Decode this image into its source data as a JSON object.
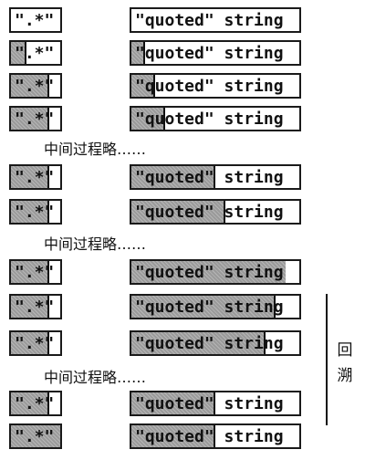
{
  "pattern_text": "\".*\"",
  "subject_text": "\"quoted\" string",
  "ellipsis_note": "中间过程略……",
  "backtrack_label": "回溯",
  "colors": {
    "border": "#1a1a1a",
    "shaded": "#9a9a9a",
    "background": "#ffffff"
  },
  "steps": [
    {
      "pattern_matched": 0,
      "pattern_cursor": 0,
      "subject_matched": 0,
      "subject_cursor": 0
    },
    {
      "pattern_matched": 1,
      "pattern_cursor": 1,
      "subject_matched": 1,
      "subject_cursor": 1
    },
    {
      "pattern_matched": 3,
      "pattern_cursor": 3,
      "subject_matched": 2,
      "subject_cursor": 2
    },
    {
      "pattern_matched": 3,
      "pattern_cursor": 3,
      "subject_matched": 3,
      "subject_cursor": 3
    },
    {
      "note": true
    },
    {
      "pattern_matched": 3,
      "pattern_cursor": 3,
      "subject_matched": 8,
      "subject_cursor": 8
    },
    {
      "pattern_matched": 3,
      "pattern_cursor": 3,
      "subject_matched": 9,
      "subject_cursor": 9
    },
    {
      "note": true
    },
    {
      "pattern_matched": 3,
      "pattern_cursor": 3,
      "subject_matched": 15,
      "subject_cursor": 15
    },
    {
      "pattern_matched": 3,
      "pattern_cursor": 3,
      "subject_matched": 14,
      "subject_cursor": 14
    },
    {
      "pattern_matched": 3,
      "pattern_cursor": 3,
      "subject_matched": 13,
      "subject_cursor": 13
    },
    {
      "note": true
    },
    {
      "pattern_matched": 3,
      "pattern_cursor": 3,
      "subject_matched": 8,
      "subject_cursor": 8
    },
    {
      "pattern_matched": 4,
      "pattern_cursor": 4,
      "subject_matched": 8,
      "subject_cursor": 8
    }
  ]
}
